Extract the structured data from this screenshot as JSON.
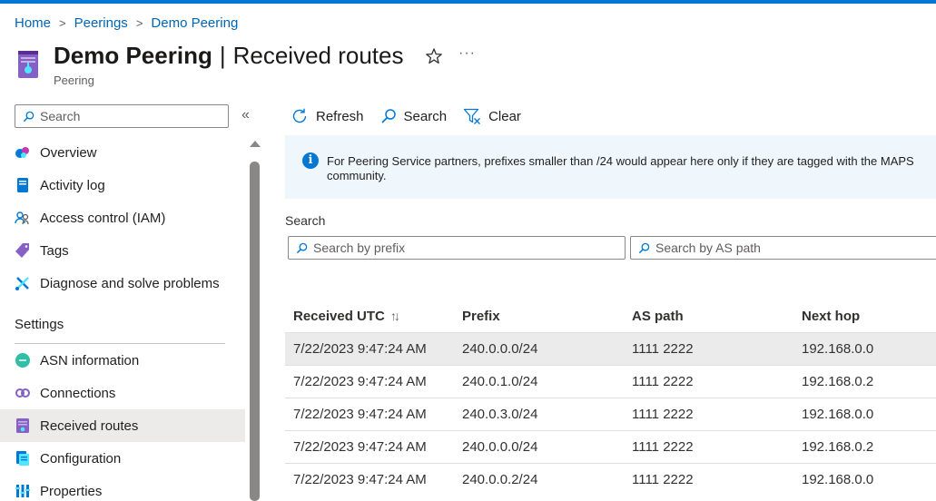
{
  "breadcrumb": [
    "Home",
    "Peerings",
    "Demo Peering"
  ],
  "header": {
    "title_main": "Demo Peering",
    "title_sep": "|",
    "title_sub": "Received routes",
    "subtitle": "Peering",
    "more_label": "···"
  },
  "sidebar": {
    "search_placeholder": "Search",
    "collapse_label": "«",
    "items": [
      {
        "label": "Overview",
        "icon": "overview-icon"
      },
      {
        "label": "Activity log",
        "icon": "activity-log-icon"
      },
      {
        "label": "Access control (IAM)",
        "icon": "people-icon"
      },
      {
        "label": "Tags",
        "icon": "tag-icon"
      },
      {
        "label": "Diagnose and solve problems",
        "icon": "wrench-icon"
      }
    ],
    "section_title": "Settings",
    "settings_items": [
      {
        "label": "ASN information",
        "icon": "asn-icon"
      },
      {
        "label": "Connections",
        "icon": "connections-icon"
      },
      {
        "label": "Received routes",
        "icon": "peering-icon",
        "active": true
      },
      {
        "label": "Configuration",
        "icon": "configuration-icon"
      },
      {
        "label": "Properties",
        "icon": "properties-icon"
      }
    ]
  },
  "toolbar": {
    "refresh_label": "Refresh",
    "search_label": "Search",
    "clear_label": "Clear"
  },
  "info": {
    "text": "For Peering Service partners, prefixes smaller than /24 would appear here only if they are tagged with the MAPS community."
  },
  "search": {
    "label": "Search",
    "prefix_placeholder": "Search by prefix",
    "aspath_placeholder": "Search by AS path"
  },
  "table": {
    "headers": [
      "Received UTC",
      "Prefix",
      "AS path",
      "Next hop"
    ],
    "sort_indicator": "↑↓",
    "rows": [
      [
        "7/22/2023 9:47:24 AM",
        "240.0.0.0/24",
        "1111 2222",
        "192.168.0.0"
      ],
      [
        "7/22/2023 9:47:24 AM",
        "240.0.1.0/24",
        "1111 2222",
        "192.168.0.2"
      ],
      [
        "7/22/2023 9:47:24 AM",
        "240.0.3.0/24",
        "1111 2222",
        "192.168.0.0"
      ],
      [
        "7/22/2023 9:47:24 AM",
        "240.0.0.0/24",
        "1111 2222",
        "192.168.0.2"
      ],
      [
        "7/22/2023 9:47:24 AM",
        "240.0.0.2/24",
        "1111 2222",
        "192.168.0.0"
      ]
    ]
  },
  "colors": {
    "accent": "#0078d4",
    "link": "#0065b3",
    "info_bg": "#eff6fc",
    "selected_bg": "#ebebeb"
  }
}
